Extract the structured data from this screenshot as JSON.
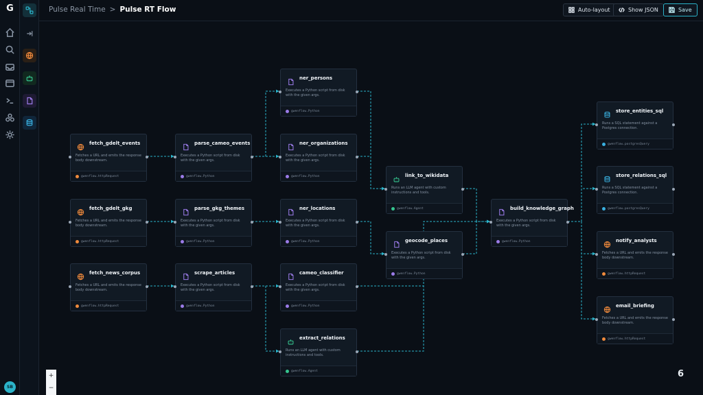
{
  "app": {
    "logo": "G",
    "avatar_initials": "SB"
  },
  "rail": [
    "home-icon",
    "search-icon",
    "inbox-icon",
    "window-icon",
    "terminal-icon",
    "cluster-icon",
    "gear-icon"
  ],
  "palette": [
    "flow-icon",
    "collapse-icon",
    "globe-icon",
    "robot-icon",
    "python-file-icon",
    "database-icon"
  ],
  "breadcrumb": {
    "parent": "Pulse Real Time",
    "separator": ">",
    "current": "Pulse RT Flow"
  },
  "toolbar": {
    "autolayout": "Auto-layout",
    "showjson": "Show JSON",
    "save": "Save"
  },
  "colors": {
    "accent": "#2bb3c9",
    "http": "#f08a3c",
    "python": "#9b7be8",
    "agent": "#35c58f",
    "sql": "#39b0e0"
  },
  "nodes": {
    "fetch_gdelt_events": {
      "title": "fetch_gdelt_events",
      "desc": "Fetches a URL and emits the response body downstream.",
      "footer": "gwenflow.httpRequest",
      "kind": "http"
    },
    "fetch_gdelt_gkg": {
      "title": "fetch_gdelt_gkg",
      "desc": "Fetches a URL and emits the response body downstream.",
      "footer": "gwenflow.httpRequest",
      "kind": "http"
    },
    "fetch_news_corpus": {
      "title": "fetch_news_corpus",
      "desc": "Fetches a URL and emits the response body downstream.",
      "footer": "gwenflow.httpRequest",
      "kind": "http"
    },
    "parse_cameo_events": {
      "title": "parse_cameo_events",
      "desc": "Executes a Python script from disk with the given args.",
      "footer": "gwenflow.Python",
      "kind": "python"
    },
    "parse_gkg_themes": {
      "title": "parse_gkg_themes",
      "desc": "Executes a Python script from disk with the given args.",
      "footer": "gwenflow.Python",
      "kind": "python"
    },
    "scrape_articles": {
      "title": "scrape_articles",
      "desc": "Executes a Python script from disk with the given args.",
      "footer": "gwenflow.Python",
      "kind": "python"
    },
    "ner_persons": {
      "title": "ner_persons",
      "desc": "Executes a Python script from disk with the given args.",
      "footer": "gwenflow.Python",
      "kind": "python"
    },
    "ner_organizations": {
      "title": "ner_organizations",
      "desc": "Executes a Python script from disk with the given args.",
      "footer": "gwenflow.Python",
      "kind": "python"
    },
    "ner_locations": {
      "title": "ner_locations",
      "desc": "Executes a Python script from disk with the given args.",
      "footer": "gwenflow.Python",
      "kind": "python"
    },
    "cameo_classifier": {
      "title": "cameo_classifier",
      "desc": "Executes a Python script from disk with the given args.",
      "footer": "gwenflow.Python",
      "kind": "python"
    },
    "extract_relations": {
      "title": "extract_relations",
      "desc": "Runs an LLM agent with custom instructions and tools.",
      "footer": "gwenflow.Agent",
      "kind": "agent"
    },
    "link_to_wikidata": {
      "title": "link_to_wikidata",
      "desc": "Runs an LLM agent with custom instructions and tools.",
      "footer": "gwenflow.Agent",
      "kind": "agent"
    },
    "geocode_places": {
      "title": "geocode_places",
      "desc": "Executes a Python script from disk with the given args.",
      "footer": "gwenflow.Python",
      "kind": "python"
    },
    "build_knowledge_graph": {
      "title": "build_knowledge_graph",
      "desc": "Executes a Python script from disk with the given args.",
      "footer": "gwenflow.Python",
      "kind": "python"
    },
    "store_entities_sql": {
      "title": "store_entities_sql",
      "desc": "Runs a SQL statement against a Postgres connection.",
      "footer": "gwenflow.postgresQuery",
      "kind": "sql"
    },
    "store_relations_sql": {
      "title": "store_relations_sql",
      "desc": "Runs a SQL statement against a Postgres connection.",
      "footer": "gwenflow.postgresQuery",
      "kind": "sql"
    },
    "notify_analysts": {
      "title": "notify_analysts",
      "desc": "Fetches a URL and emits the response body downstream.",
      "footer": "gwenflow.httpRequest",
      "kind": "http"
    },
    "email_briefing": {
      "title": "email_briefing",
      "desc": "Fetches a URL and emits the response body downstream.",
      "footer": "gwenflow.httpRequest",
      "kind": "http"
    }
  },
  "edges": [
    [
      "fetch_gdelt_events",
      "parse_cameo_events"
    ],
    [
      "fetch_gdelt_gkg",
      "parse_gkg_themes"
    ],
    [
      "fetch_news_corpus",
      "scrape_articles"
    ],
    [
      "parse_cameo_events",
      "ner_persons"
    ],
    [
      "parse_cameo_events",
      "ner_organizations"
    ],
    [
      "parse_gkg_themes",
      "ner_locations"
    ],
    [
      "scrape_articles",
      "cameo_classifier"
    ],
    [
      "scrape_articles",
      "extract_relations"
    ],
    [
      "ner_persons",
      "link_to_wikidata"
    ],
    [
      "ner_organizations",
      "link_to_wikidata"
    ],
    [
      "ner_locations",
      "geocode_places"
    ],
    [
      "cameo_classifier",
      "build_knowledge_graph"
    ],
    [
      "extract_relations",
      "build_knowledge_graph"
    ],
    [
      "link_to_wikidata",
      "build_knowledge_graph"
    ],
    [
      "geocode_places",
      "build_knowledge_graph"
    ],
    [
      "build_knowledge_graph",
      "store_entities_sql"
    ],
    [
      "build_knowledge_graph",
      "store_relations_sql"
    ],
    [
      "build_knowledge_graph",
      "notify_analysts"
    ],
    [
      "build_knowledge_graph",
      "email_briefing"
    ]
  ],
  "zoom_controls": {
    "plus": "+",
    "minus": "−"
  },
  "corner_badge": "6"
}
